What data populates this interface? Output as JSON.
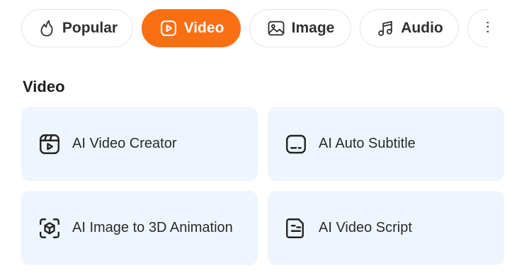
{
  "tabs": [
    {
      "label": "Popular",
      "icon": "flame-icon",
      "active": false
    },
    {
      "label": "Video",
      "icon": "play-square-icon",
      "active": true
    },
    {
      "label": "Image",
      "icon": "image-icon",
      "active": false
    },
    {
      "label": "Audio",
      "icon": "music-note-icon",
      "active": false
    },
    {
      "label": "",
      "icon": "partially-visible-icon",
      "active": false
    }
  ],
  "section": {
    "title": "Video"
  },
  "cards": [
    {
      "label": "AI Video Creator",
      "icon": "video-creator-icon"
    },
    {
      "label": "AI Auto Subtitle",
      "icon": "subtitle-icon"
    },
    {
      "label": "AI Image to 3D Animation",
      "icon": "cube-scan-icon"
    },
    {
      "label": "AI Video Script",
      "icon": "script-document-icon"
    }
  ],
  "colors": {
    "accent": "#fb6f13",
    "card_background": "#eef5fd",
    "tab_border": "#e3e6ea"
  }
}
